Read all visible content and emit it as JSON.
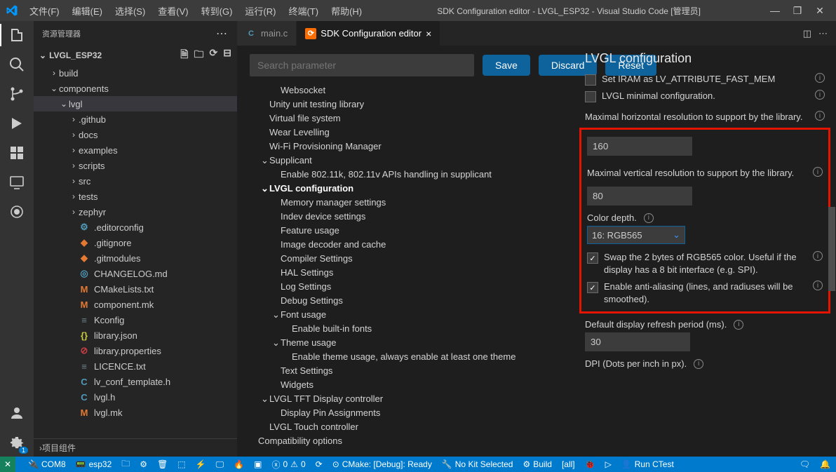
{
  "menus": [
    "文件(F)",
    "编辑(E)",
    "选择(S)",
    "查看(V)",
    "转到(G)",
    "运行(R)",
    "终端(T)",
    "帮助(H)"
  ],
  "window_title": "SDK Configuration editor - LVGL_ESP32 - Visual Studio Code [管理员]",
  "sidebar_title": "资源管理器",
  "project_name": "LVGL_ESP32",
  "tree": [
    {
      "depth": 1,
      "chev": "›",
      "label": "build",
      "cls": ""
    },
    {
      "depth": 1,
      "chev": "⌄",
      "label": "components",
      "cls": ""
    },
    {
      "depth": 2,
      "chev": "⌄",
      "label": "lvgl",
      "cls": "selected"
    },
    {
      "depth": 3,
      "chev": "›",
      "label": ".github",
      "cls": ""
    },
    {
      "depth": 3,
      "chev": "›",
      "label": "docs",
      "cls": ""
    },
    {
      "depth": 3,
      "chev": "›",
      "label": "examples",
      "cls": ""
    },
    {
      "depth": 3,
      "chev": "›",
      "label": "scripts",
      "cls": ""
    },
    {
      "depth": 3,
      "chev": "›",
      "label": "src",
      "cls": ""
    },
    {
      "depth": 3,
      "chev": "›",
      "label": "tests",
      "cls": ""
    },
    {
      "depth": 3,
      "chev": "›",
      "label": "zephyr",
      "cls": ""
    },
    {
      "depth": 3,
      "icon": "⚙",
      "ic_color": "#519aba",
      "label": ".editorconfig",
      "cls": ""
    },
    {
      "depth": 3,
      "icon": "◆",
      "ic_color": "#e37933",
      "label": ".gitignore",
      "cls": ""
    },
    {
      "depth": 3,
      "icon": "◆",
      "ic_color": "#e37933",
      "label": ".gitmodules",
      "cls": ""
    },
    {
      "depth": 3,
      "icon": "◎",
      "ic_color": "#519aba",
      "label": "CHANGELOG.md",
      "cls": ""
    },
    {
      "depth": 3,
      "icon": "M",
      "ic_color": "#e37933",
      "label": "CMakeLists.txt",
      "cls": ""
    },
    {
      "depth": 3,
      "icon": "M",
      "ic_color": "#e37933",
      "label": "component.mk",
      "cls": ""
    },
    {
      "depth": 3,
      "icon": "≡",
      "ic_color": "#6d8086",
      "label": "Kconfig",
      "cls": ""
    },
    {
      "depth": 3,
      "icon": "{}",
      "ic_color": "#cbcb41",
      "label": "library.json",
      "cls": ""
    },
    {
      "depth": 3,
      "icon": "⊘",
      "ic_color": "#cc3e44",
      "label": "library.properties",
      "cls": ""
    },
    {
      "depth": 3,
      "icon": "≡",
      "ic_color": "#6d8086",
      "label": "LICENCE.txt",
      "cls": ""
    },
    {
      "depth": 3,
      "icon": "C",
      "ic_color": "#519aba",
      "label": "lv_conf_template.h",
      "cls": ""
    },
    {
      "depth": 3,
      "icon": "C",
      "ic_color": "#519aba",
      "label": "lvgl.h",
      "cls": ""
    },
    {
      "depth": 3,
      "icon": "M",
      "ic_color": "#e37933",
      "label": "lvgl.mk",
      "cls": ""
    }
  ],
  "sidebar_footer_chev": "›",
  "sidebar_footer": "项目组件",
  "tabs": [
    {
      "icon": "C",
      "ic_color": "#519aba",
      "label": "main.c",
      "active": false,
      "close": ""
    },
    {
      "icon": "⟳",
      "ic_color": "#ff6c00",
      "label": "SDK Configuration editor",
      "active": true,
      "close": "×"
    }
  ],
  "search_placeholder": "Search parameter",
  "buttons": {
    "save": "Save",
    "discard": "Discard",
    "reset": "Reset"
  },
  "config_tree": [
    {
      "d": "d1",
      "chev": "",
      "txt": "Websocket"
    },
    {
      "d": "",
      "chev": "",
      "txt": "Unity unit testing library"
    },
    {
      "d": "",
      "chev": "",
      "txt": "Virtual file system"
    },
    {
      "d": "",
      "chev": "",
      "txt": "Wear Levelling"
    },
    {
      "d": "",
      "chev": "",
      "txt": "Wi-Fi Provisioning Manager"
    },
    {
      "d": "",
      "chev": "⌄",
      "txt": "Supplicant"
    },
    {
      "d": "d1",
      "chev": "",
      "txt": "Enable 802.11k, 802.11v APIs handling in supplicant"
    },
    {
      "d": "",
      "chev": "⌄",
      "txt": "LVGL configuration",
      "bold": true
    },
    {
      "d": "d1",
      "chev": "",
      "txt": "Memory manager settings"
    },
    {
      "d": "d1",
      "chev": "",
      "txt": "Indev device settings"
    },
    {
      "d": "d1",
      "chev": "",
      "txt": "Feature usage"
    },
    {
      "d": "d1",
      "chev": "",
      "txt": "Image decoder and cache"
    },
    {
      "d": "d1",
      "chev": "",
      "txt": "Compiler Settings"
    },
    {
      "d": "d1",
      "chev": "",
      "txt": "HAL Settings"
    },
    {
      "d": "d1",
      "chev": "",
      "txt": "Log Settings"
    },
    {
      "d": "d1",
      "chev": "",
      "txt": "Debug Settings"
    },
    {
      "d": "d1",
      "chev": "⌄",
      "txt": "Font usage"
    },
    {
      "d": "d2",
      "chev": "",
      "txt": "Enable built-in fonts"
    },
    {
      "d": "d1",
      "chev": "⌄",
      "txt": "Theme usage"
    },
    {
      "d": "d2",
      "chev": "",
      "txt": "Enable theme usage, always enable at least one theme"
    },
    {
      "d": "d1",
      "chev": "",
      "txt": "Text Settings"
    },
    {
      "d": "d1",
      "chev": "",
      "txt": "Widgets"
    },
    {
      "d": "",
      "chev": "⌄",
      "txt": "LVGL TFT Display controller"
    },
    {
      "d": "d1",
      "chev": "",
      "txt": "Display Pin Assignments"
    },
    {
      "d": "",
      "chev": "",
      "txt": "LVGL Touch controller"
    },
    {
      "d": "",
      "chev": "",
      "txt": "Compatibility options",
      "outdent": true
    }
  ],
  "details": {
    "heading": "LVGL configuration",
    "iram": "Set IRAM as LV_ATTRIBUTE_FAST_MEM",
    "minimal": "LVGL minimal configuration.",
    "hres_label": "Maximal horizontal resolution to support by the library.",
    "hres_value": "160",
    "vres_label": "Maximal vertical resolution to support by the library.",
    "vres_value": "80",
    "colordepth_label": "Color depth.",
    "colordepth_value": "16: RGB565",
    "swap_label": "Swap the 2 bytes of RGB565 color. Useful if the display has a 8 bit interface (e.g. SPI).",
    "aa_label": "Enable anti-aliasing (lines, and radiuses will be smoothed).",
    "refresh_label": "Default display refresh period (ms).",
    "refresh_value": "30",
    "dpi_label": "DPI (Dots per inch in px)."
  },
  "statusbar": {
    "remote_x": "✕",
    "com": "COM8",
    "chip": "esp32",
    "cmake": "CMake: [Debug]: Ready",
    "kit": "No Kit Selected",
    "build": "Build",
    "target": "[all]",
    "ctest": "Run CTest",
    "errs": "0",
    "warns": "0"
  }
}
